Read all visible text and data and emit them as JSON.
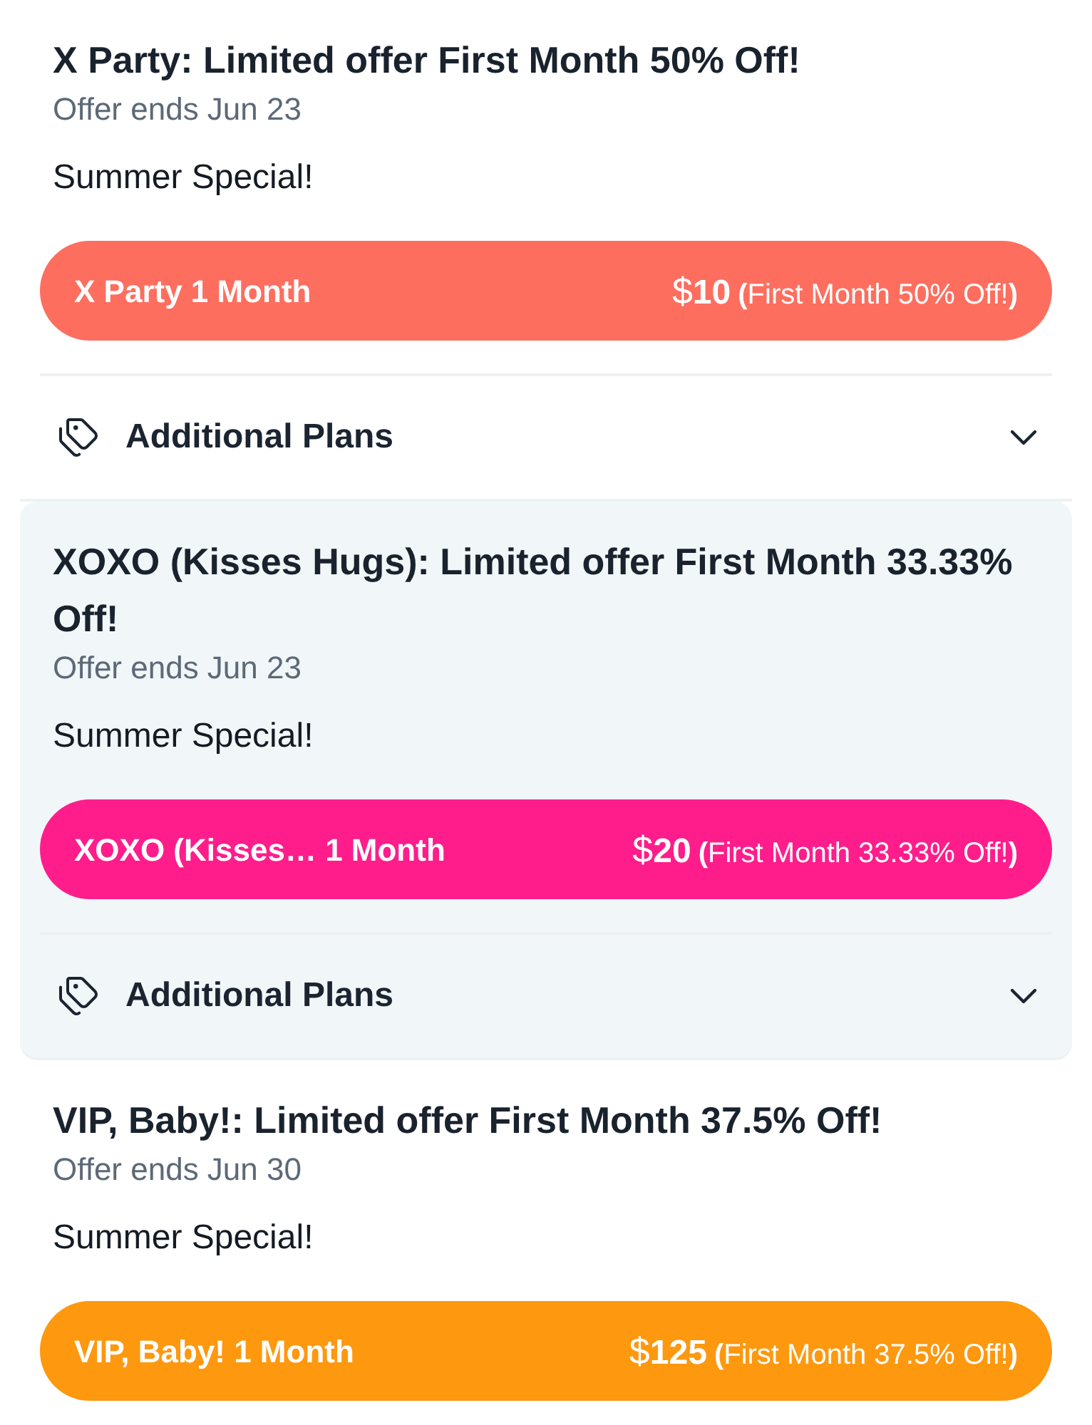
{
  "offers": [
    {
      "title": "X Party: Limited offer First Month 50% Off!",
      "offer_ends": "Offer ends Jun 23",
      "tagline": "Summer Special!",
      "selected": false,
      "plan_button": {
        "plan": "X Party 1 Month",
        "currency": "$",
        "price": "10",
        "note": "**(**First Month 50% Off!**)**",
        "color": "#fd6e5f"
      },
      "additional_plans": {
        "label": "Additional Plans",
        "expanded": false
      }
    },
    {
      "title": "XOXO (Kisses Hugs): Limited offer First Month 33.33% Off!",
      "offer_ends": "Offer ends Jun 23",
      "tagline": "Summer Special!",
      "selected": true,
      "plan_button": {
        "plan": "XOXO (Kisses… 1 Month",
        "currency": "$",
        "price": "20",
        "note": "**(**First Month 33.33% Off!**)**",
        "color": "#fe1d8b"
      },
      "additional_plans": {
        "label": "Additional Plans",
        "expanded": false
      }
    },
    {
      "title": "VIP, Baby!: Limited offer First Month 37.5% Off!",
      "offer_ends": "Offer ends Jun 30",
      "tagline": "Summer Special!",
      "selected": false,
      "plan_button": {
        "plan": "VIP, Baby! 1 Month",
        "currency": "$",
        "price": "125",
        "note": "**(**First Month 37.5% Off!**)**",
        "color": "#fd980f"
      }
    }
  ]
}
